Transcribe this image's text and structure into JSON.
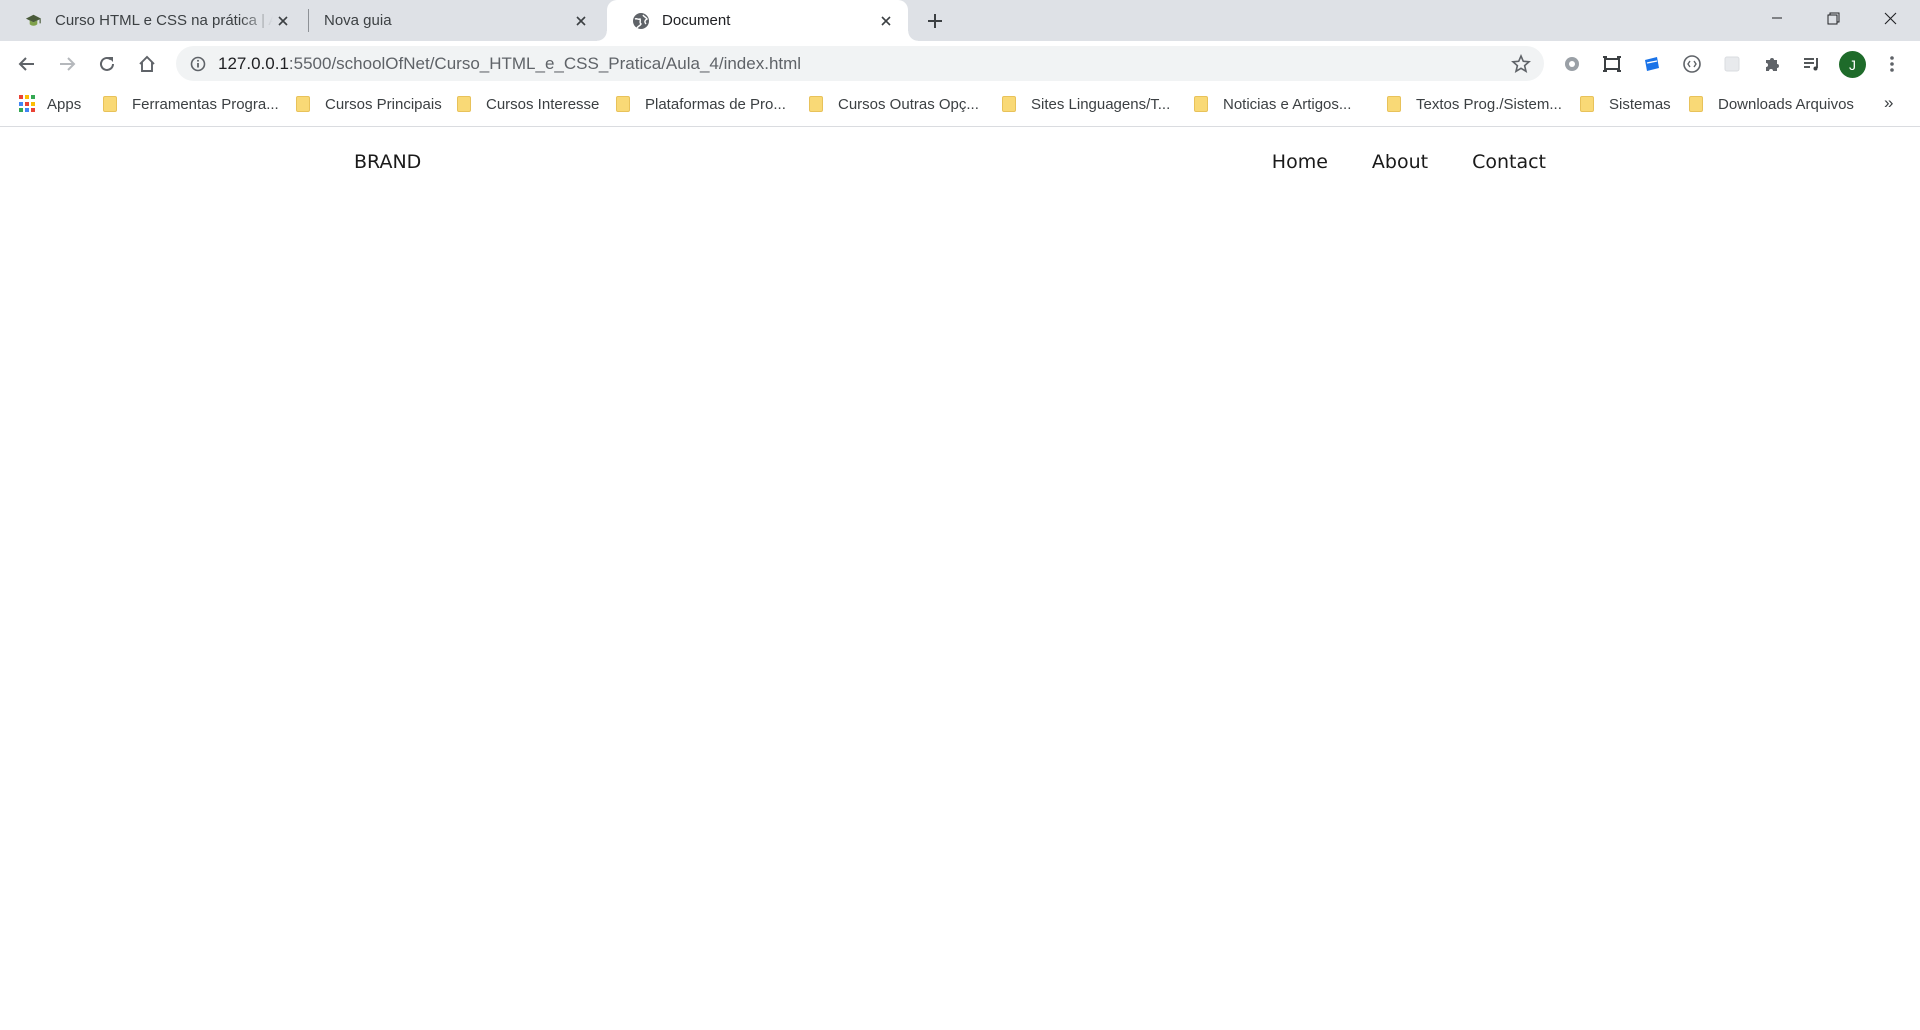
{
  "browser": {
    "tabs": [
      {
        "title": "Curso HTML e CSS na prática | Aula",
        "favicon": "graduation-cap-icon",
        "active": false
      },
      {
        "title": "Nova guia",
        "favicon": "",
        "active": false
      },
      {
        "title": "Document",
        "favicon": "globe-icon",
        "active": true
      }
    ],
    "address_bar": {
      "host": "127.0.0.1",
      "path": ":5500/schoolOfNet/Curso_HTML_e_CSS_Pratica/Aula_4/index.html"
    },
    "profile_initial": "J",
    "bookmarks": {
      "apps_label": "Apps",
      "items": [
        "Ferramentas Progra...",
        "Cursos Principais",
        "Cursos Interesse",
        "Plataformas de Pro...",
        "Cursos Outras Opç...",
        "Sites Linguagens/T...",
        "Noticias e Artigos...",
        "Textos Prog./Sistem...",
        "Sistemas",
        "Downloads Arquivos"
      ],
      "overflow": "»"
    },
    "colors": {
      "tabstrip": "#dee1e6",
      "omnibox": "#f1f3f4",
      "avatar": "#1e6b2a",
      "folder": "#f9d976"
    }
  },
  "page": {
    "brand": "BRAND",
    "nav": [
      "Home",
      "About",
      "Contact"
    ]
  }
}
